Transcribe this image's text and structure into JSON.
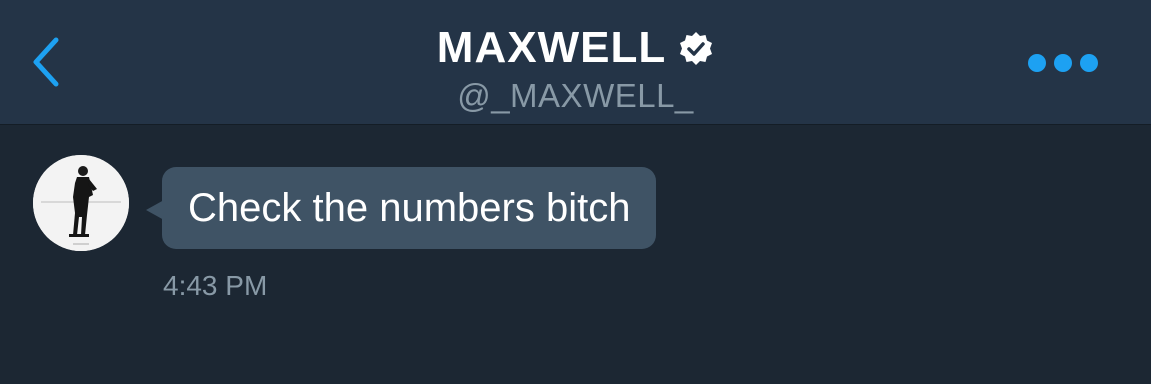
{
  "header": {
    "title": "MAXWELL",
    "handle": "@_MAXWELL_",
    "verified": true,
    "back_icon": "chevron-left-icon",
    "more_icon": "more-horizontal-icon",
    "accent_color": "#1da1f2"
  },
  "conversation": {
    "messages": [
      {
        "text": "Check the numbers bitch",
        "time": "4:43 PM",
        "sender": "received"
      }
    ]
  },
  "colors": {
    "background": "#1c2733",
    "header": "#243447",
    "bubble": "#3f5365",
    "secondary_text": "#8899a6"
  }
}
